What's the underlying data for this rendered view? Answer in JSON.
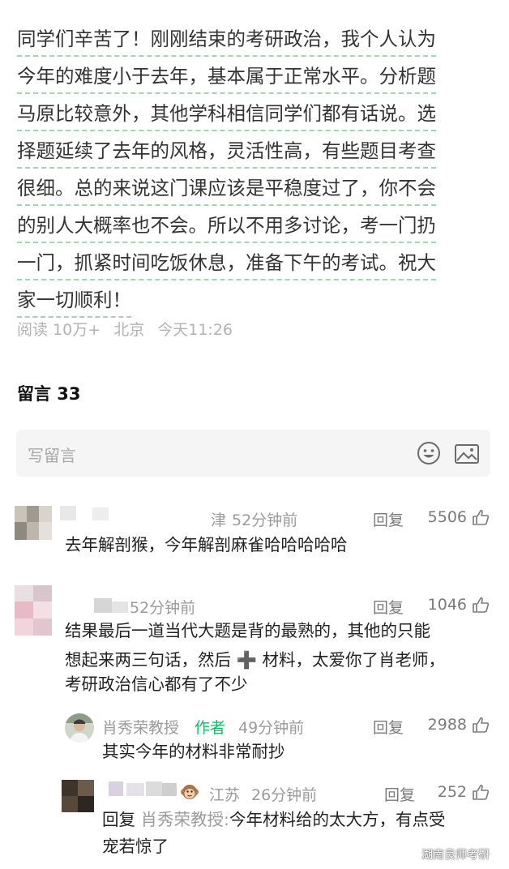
{
  "article": {
    "lines": [
      "同学们辛苦了！刚刚结束的考研政治，我个人认为",
      "今年的难度小于去年，基本属于正常水平。分析题",
      "马原比较意外，其他学科相信同学们都有话说。选",
      "择题延续了去年的风格，灵活性高，有些题目考查",
      "很细。总的来说这门课应该是平稳度过了，你不会",
      "的别人大概率也不会。所以不用多讨论，考一门扔",
      "一门，抓紧时间吃饭休息，准备下午的考试。祝大",
      "家一切顺利！"
    ]
  },
  "meta": {
    "reads": "阅读 10万+",
    "location": "北京",
    "time": "今天11:26"
  },
  "comments_header": "留言 33",
  "write_box": {
    "placeholder": "写留言",
    "emoji_icon": "smiley-icon",
    "image_icon": "image-icon"
  },
  "comments": [
    {
      "name_partial": "津",
      "time": "52分钟前",
      "reply_label": "回复",
      "likes": "5506",
      "text": [
        "去年解剖猴，今年解剖麻雀哈哈哈哈哈"
      ]
    },
    {
      "time": "52分钟前",
      "reply_label": "回复",
      "likes": "1046",
      "text": [
        "结果最后一道当代大题是背的最熟的，其他的只能",
        "想起来两三句话，然后 ➕ 材料，太爱你了肖老师，",
        "考研政治信心都有了不少"
      ]
    }
  ],
  "reply": {
    "name": "肖秀荣教授",
    "tag": "作者",
    "time": "49分钟前",
    "reply_label": "回复",
    "likes": "2988",
    "text": "其实今年的材料非常耐抄"
  },
  "sub_reply": {
    "location": "江苏",
    "time": "26分钟前",
    "reply_label": "回复",
    "likes": "252",
    "prefix": "回复",
    "quote_name": "肖秀荣教授:",
    "text_line1": "今年材料给的太大方，有点受",
    "text_line2": "宠若惊了"
  },
  "watermark": "湖南良师考研",
  "colors": {
    "underline": "#9fd7b3",
    "author": "#07c160",
    "meta": "#b2b2b2"
  }
}
